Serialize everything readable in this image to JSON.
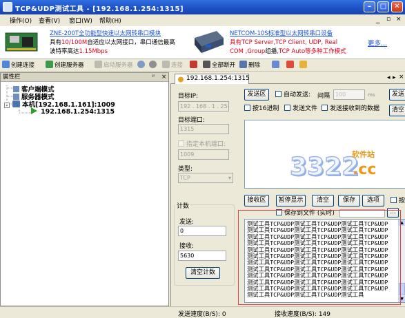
{
  "window": {
    "title": "TCP&UDP测试工具 - [192.168.1.254:1315]"
  },
  "menu": [
    "操作(O)",
    "查看(V)",
    "窗口(W)",
    "帮助(H)"
  ],
  "banner": {
    "ad1_title": "ZNE-200T全功能型快速以太网转串口模块",
    "ad1_l2_a": "具有",
    "ad1_l2_b": "10/100M",
    "ad1_l2_c": "自适应以太网接口，串口通信最高",
    "ad1_l3_a": "波特率高达",
    "ad1_l3_b": "1.15Mbps",
    "ad2_title": "NETCOM-10S标准型以太网转串口设备",
    "ad2_l2": "具有TCP Server,TCP Client, UDP, Real",
    "ad2_l3_a": "COM ,Group",
    "ad2_l3_b": "组播",
    "ad2_l3_c": ",TCP Auto等多种工作模式",
    "more": "更多..."
  },
  "toolbar": {
    "create_conn": "创建连接",
    "create_server": "创建服务器",
    "start_server": "启动服务器",
    "connect": "连接",
    "disconnect_all": "全部断开",
    "delete": "删除"
  },
  "leftpanel": {
    "header": "属性栏",
    "pin": "ᵖ",
    "close": "×",
    "tree": {
      "client_mode": "客户端模式",
      "server_mode": "服务器模式",
      "local": "本机[192.168.1.161]:1009",
      "session": "192.168.1.254:1315"
    }
  },
  "tab": {
    "label": "192.168.1.254:1315"
  },
  "form": {
    "target_ip_label": "目标IP:",
    "target_ip": "192 . 168 . 1 . 254",
    "target_port_label": "目标端口:",
    "target_port": "1315",
    "bind_local_port": "指定本机端口:",
    "local_port": "1009",
    "type_label": "类型:",
    "type_value": "TCP"
  },
  "counter": {
    "title": "计数",
    "send_label": "发送:",
    "send_value": "0",
    "recv_label": "接收:",
    "recv_value": "5630",
    "clear_btn": "清空计数"
  },
  "send_area": {
    "title_btn": "发送区",
    "auto_send": "自动发送:",
    "interval_label": "间隔",
    "interval_value": "100",
    "interval_unit": "ms",
    "send_btn": "发送",
    "hex": "按16进制",
    "send_file": "发送文件",
    "send_recv": "发送接收到的数据",
    "clear_btn": "清空"
  },
  "recv_area": {
    "title_btn": "接收区",
    "pause_btn": "暂停显示",
    "clear_btn": "清空",
    "save_btn": "保存",
    "options_btn": "选项",
    "save_to_file": "保存到文件 (实时)",
    "lines": [
      "测试工具TCP&UDP测试工具TCP&UDP测试工具TCP&UDP",
      "测试工具TCP&UDP测试工具TCP&UDP测试工具TCP&UDP",
      "测试工具TCP&UDP测试工具TCP&UDP测试工具TCP&UDP",
      "测试工具TCP&UDP测试工具TCP&UDP测试工具TCP&UDP",
      "测试工具TCP&UDP测试工具TCP&UDP测试工具TCP&UDP",
      "测试工具TCP&UDP测试工具TCP&UDP测试工具TCP&UDP",
      "测试工具TCP&UDP测试工具TCP&UDP测试工具TCP&UDP",
      "测试工具TCP&UDP测试工具TCP&UDP测试工具TCP&UDP",
      "测试工具TCP&UDP测试工具TCP&UDP测试工具TCP&UDP",
      "测试工具TCP&UDP测试工具TCP&UDP测试工具TCP&UDP",
      "测试工具TCP&UDP测试工具TCP&UDP测试工具TCP&UDP",
      "测试工具TCP&UDP测试工具TCP&UDP测试工具"
    ]
  },
  "status": {
    "send_speed": "发送速度(B/S): 0",
    "recv_speed": "接收速度(B/S): 149"
  },
  "watermark": {
    "num": "3322",
    "dot": ".cc",
    "site": "软件站"
  }
}
